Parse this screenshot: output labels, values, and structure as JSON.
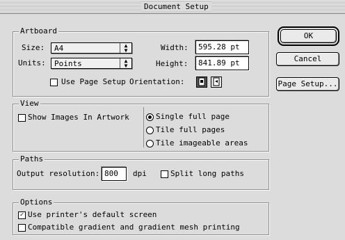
{
  "window": {
    "title": "Document Setup"
  },
  "artboard": {
    "label": "Artboard",
    "size_label": "Size:",
    "size_value": "A4",
    "units_label": "Units:",
    "units_value": "Points",
    "width_label": "Width:",
    "width_value": "595.28 pt",
    "height_label": "Height:",
    "height_value": "841.89 pt",
    "use_page_setup_label": "Use Page Setup",
    "use_page_setup_checked": false,
    "orientation_label": "Orientation:",
    "orientation_selected": "portrait"
  },
  "view": {
    "label": "View",
    "show_images_label": "Show Images In Artwork",
    "show_images_checked": false,
    "options": [
      "Single full page",
      "Tile full pages",
      "Tile imageable areas"
    ],
    "selected_index": 0
  },
  "paths": {
    "label": "Paths",
    "output_resolution_label": "Output resolution:",
    "output_resolution_value": "800",
    "unit_label": "dpi",
    "split_long_paths_label": "Split long paths",
    "split_long_paths_checked": false
  },
  "options": {
    "label": "Options",
    "printer_screen_label": "Use printer's default screen",
    "printer_screen_checked": true,
    "compatible_gradient_label": "Compatible gradient and gradient mesh printing",
    "compatible_gradient_checked": false
  },
  "buttons": {
    "ok": "OK",
    "cancel": "Cancel",
    "page_setup": "Page Setup..."
  }
}
